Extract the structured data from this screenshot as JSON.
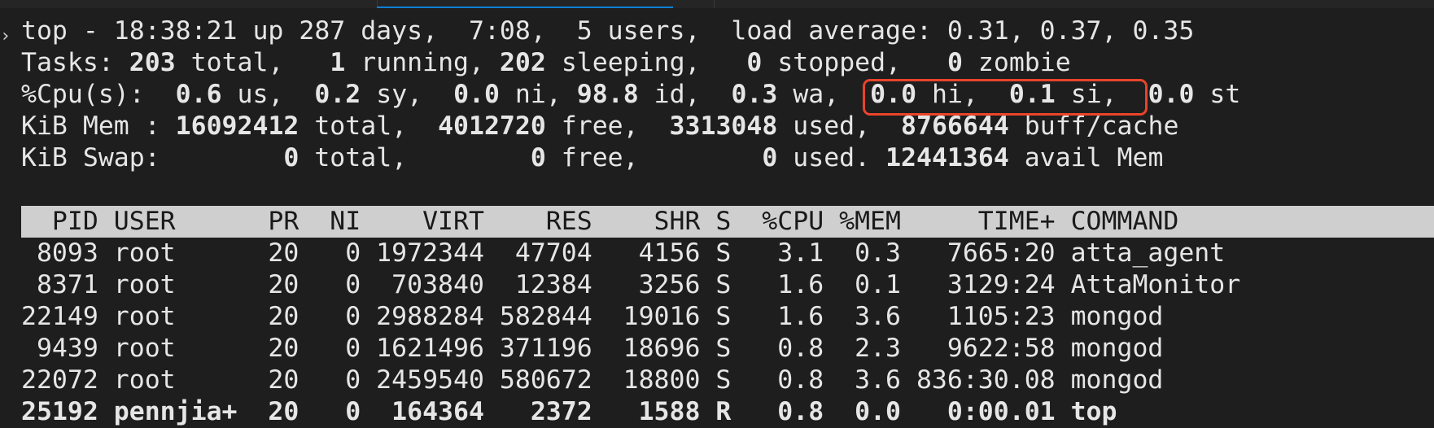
{
  "terminal": {
    "summary": {
      "line1": "top - 18:38:21 up 287 days,  7:08,  5 users,  load average: 0.31, 0.37, 0.35",
      "tasks": {
        "label": "Tasks: ",
        "total": "203",
        "total_lbl": " total,   ",
        "running": "1",
        "running_lbl": " running, ",
        "sleeping": "202",
        "sleeping_lbl": " sleeping,   ",
        "stopped": "0",
        "stopped_lbl": " stopped,   ",
        "zombie": "0",
        "zombie_lbl": " zombie"
      },
      "cpu": {
        "label": "%Cpu(s):  ",
        "us": "0.6",
        "us_lbl": " us,  ",
        "sy": "0.2",
        "sy_lbl": " sy,  ",
        "ni": "0.0",
        "ni_lbl": " ni, ",
        "id": "98.8",
        "id_lbl": " id,  ",
        "wa": "0.3",
        "wa_lbl": " wa,  ",
        "hi": "0.0",
        "hi_lbl": " hi,  ",
        "si": "0.1",
        "si_lbl": " si,  ",
        "st": "0.0",
        "st_lbl": " st"
      },
      "mem": {
        "label": "KiB Mem : ",
        "total": "16092412",
        "total_lbl": " total,  ",
        "free": "4012720",
        "free_lbl": " free,  ",
        "used": "3313048",
        "used_lbl": " used,  ",
        "cache": "8766644",
        "cache_lbl": " buff/cache"
      },
      "swap": {
        "label": "KiB Swap:        ",
        "total": "0",
        "total_lbl": " total,        ",
        "free": "0",
        "free_lbl": " free,        ",
        "used": "0",
        "used_lbl": " used. ",
        "avail": "12441364",
        "avail_lbl": " avail Mem"
      }
    },
    "table": {
      "header": "  PID USER      PR  NI    VIRT    RES    SHR S  %CPU %MEM     TIME+ COMMAND",
      "rows": [
        " 8093 root      20   0 1972344  47704   4156 S   3.1  0.3   7665:20 atta_agent",
        " 8371 root      20   0  703840  12384   3256 S   1.6  0.1   3129:24 AttaMonitor",
        "22149 root      20   0 2988284 582844  19016 S   1.6  3.6   1105:23 mongod",
        " 9439 root      20   0 1621496 371196  18696 S   0.8  2.3   9622:58 mongod",
        "22072 root      20   0 2459540 580672  18800 S   0.8  3.6 836:30.08 mongod",
        "25192 pennjia+  20   0  164364   2372   1588 R   0.8  0.0   0:00.01 top"
      ]
    }
  }
}
